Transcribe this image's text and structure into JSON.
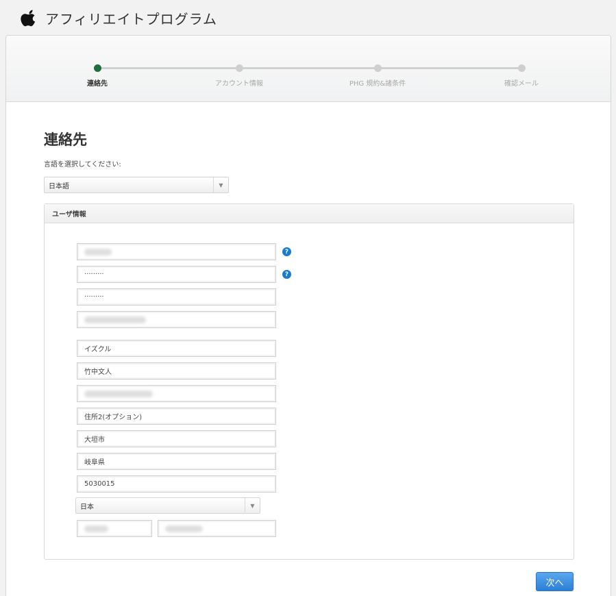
{
  "header": {
    "title": "アフィリエイトプログラム"
  },
  "steps": [
    {
      "label": "連絡先",
      "active": true
    },
    {
      "label": "アカウント情報",
      "active": false
    },
    {
      "label": "PHG 規約&諸条件",
      "active": false
    },
    {
      "label": "確認メール",
      "active": false
    }
  ],
  "section": {
    "title": "連絡先",
    "language_label": "言語を選択してください:"
  },
  "language_select": {
    "value": "日本語"
  },
  "panel": {
    "title": "ユーザ情報"
  },
  "fields": {
    "password": "·········",
    "password_confirm": "·········",
    "last_name_kana": "イズクル",
    "full_name": "竹中文人",
    "address2": "住所2(オプション)",
    "city": "大垣市",
    "prefecture": "岐阜県",
    "postal_code": "5030015"
  },
  "country_select": {
    "value": "日本"
  },
  "help": {
    "symbol": "?"
  },
  "next_button": {
    "label": "次へ"
  }
}
